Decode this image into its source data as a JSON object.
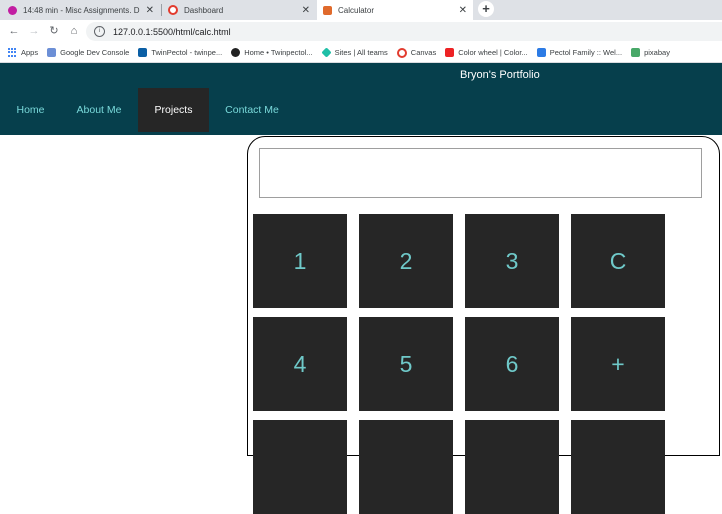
{
  "browser": {
    "tabs": [
      {
        "title": "14:48 min - Misc Assignments. D",
        "icon": "recording-icon",
        "color": "#c21ea2"
      },
      {
        "title": "Dashboard",
        "icon": "canvas-icon",
        "color": "#e23b2e"
      },
      {
        "title": "Calculator",
        "icon": "calculator-icon",
        "color": "#e06a2c"
      }
    ],
    "close_glyph": "✕",
    "newtab_glyph": "+",
    "nav": {
      "back": "←",
      "forward": "→",
      "reload": "↻",
      "home": "⌂"
    },
    "address": {
      "info_glyph": "i",
      "url": "127.0.0.1:5500/html/calc.html"
    },
    "bookmarks": [
      {
        "label": "Apps",
        "icon": "apps-grid-icon",
        "color": "#4285f4"
      },
      {
        "label": "Google Dev Console",
        "icon": "dev-console-icon",
        "color": "#6c8fd6"
      },
      {
        "label": "TwinPectol - twinpe...",
        "icon": "twinpectol-icon",
        "color": "#0b5fa5"
      },
      {
        "label": "Home • Twinpectol...",
        "icon": "twinpectol-home-icon",
        "color": "#222222"
      },
      {
        "label": "Sites | All teams",
        "icon": "sites-icon",
        "color": "#1fbfa7"
      },
      {
        "label": "Canvas",
        "icon": "canvas-icon",
        "color": "#e23b2e"
      },
      {
        "label": "Color wheel | Color...",
        "icon": "adobe-icon",
        "color": "#ed2224"
      },
      {
        "label": "Pectol Family :: Wel...",
        "icon": "pectol-family-icon",
        "color": "#2c7be5"
      },
      {
        "label": "pixabay",
        "icon": "pixabay-icon",
        "color": "#48a868"
      }
    ]
  },
  "site": {
    "title": "Bryon's Portfolio",
    "nav": [
      {
        "label": "Home",
        "active": false
      },
      {
        "label": "About Me",
        "active": false
      },
      {
        "label": "Projects",
        "active": true
      },
      {
        "label": "Contact Me",
        "active": false
      }
    ],
    "colors": {
      "header": "#063f4c",
      "link": "#79d9da",
      "active_bg": "#262626",
      "key_bg": "#262626",
      "key_text": "#6fc9c9"
    }
  },
  "calculator": {
    "display_value": "",
    "rows": [
      [
        "1",
        "2",
        "3",
        "C"
      ],
      [
        "4",
        "5",
        "6",
        "+"
      ],
      [
        "",
        "",
        "",
        ""
      ]
    ]
  }
}
